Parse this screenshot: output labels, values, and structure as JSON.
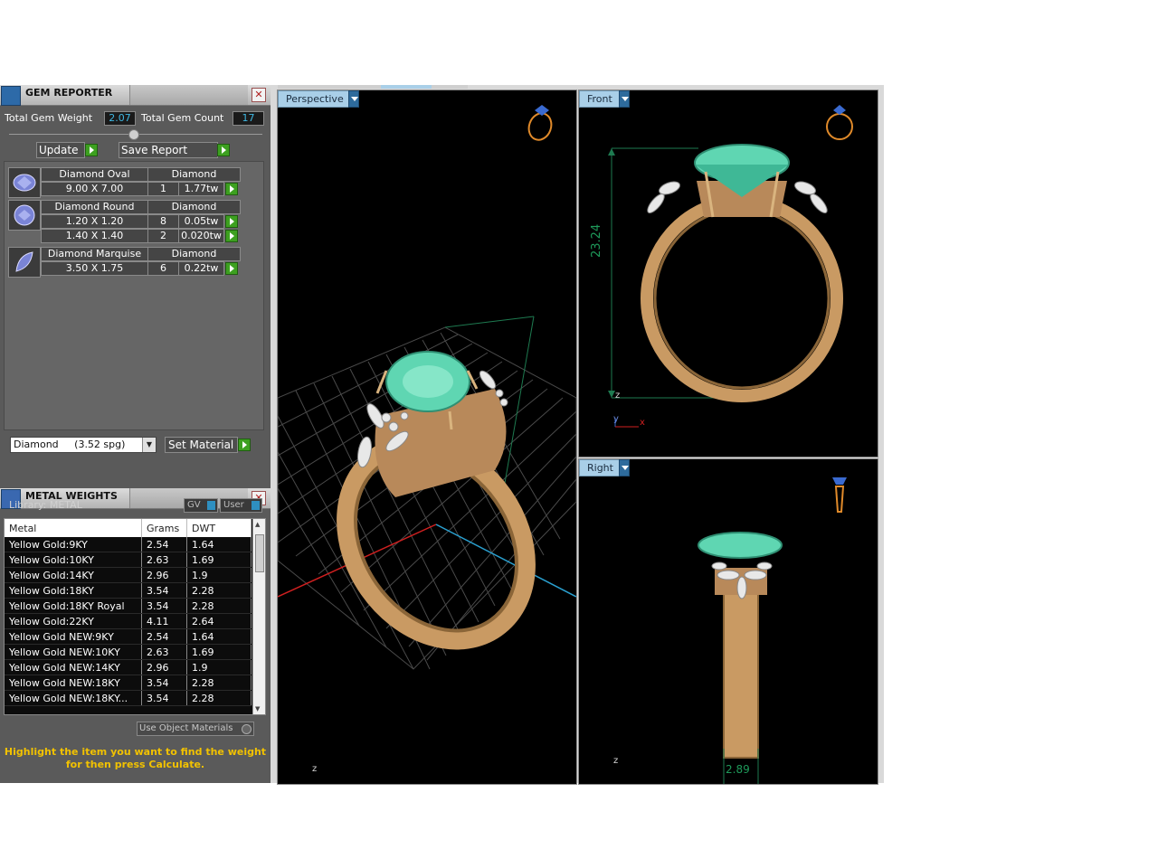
{
  "gem_reporter": {
    "title": "GEM REPORTER",
    "close_icon": "close-icon",
    "total_weight_label": "Total Gem Weight",
    "total_weight_value": "2.07",
    "total_count_label": "Total Gem Count",
    "total_count_value": "17",
    "update_label": "Update",
    "save_report_label": "Save Report",
    "gems": [
      {
        "name": "Diamond Oval",
        "material": "Diamond",
        "rows": [
          {
            "size": "9.00 X 7.00",
            "count": "1",
            "weight": "1.77tw"
          }
        ],
        "icon": "oval-gem-icon"
      },
      {
        "name": "Diamond Round",
        "material": "Diamond",
        "rows": [
          {
            "size": "1.20 X 1.20",
            "count": "8",
            "weight": "0.05tw"
          },
          {
            "size": "1.40 X 1.40",
            "count": "2",
            "weight": "0.020tw"
          }
        ],
        "icon": "round-gem-icon"
      },
      {
        "name": "Diamond Marquise",
        "material": "Diamond",
        "rows": [
          {
            "size": "3.50 X 1.75",
            "count": "6",
            "weight": "0.22tw"
          }
        ],
        "icon": "marquise-gem-icon"
      }
    ],
    "material_select": "Diamond     (3.52 spg)",
    "set_material_label": "Set Material"
  },
  "metal_weights": {
    "title": "METAL WEIGHTS",
    "library_label": "Library: METAL",
    "gv_label": "GV",
    "user_label": "User",
    "columns": [
      "Metal",
      "Grams",
      "DWT"
    ],
    "rows": [
      [
        "Yellow Gold:9KY",
        "2.54",
        "1.64"
      ],
      [
        "Yellow Gold:10KY",
        "2.63",
        "1.69"
      ],
      [
        "Yellow Gold:14KY",
        "2.96",
        "1.9"
      ],
      [
        "Yellow Gold:18KY",
        "3.54",
        "2.28"
      ],
      [
        "Yellow Gold:18KY Royal",
        "3.54",
        "2.28"
      ],
      [
        "Yellow Gold:22KY",
        "4.11",
        "2.64"
      ],
      [
        "Yellow Gold NEW:9KY",
        "2.54",
        "1.64"
      ],
      [
        "Yellow Gold NEW:10KY",
        "2.63",
        "1.69"
      ],
      [
        "Yellow Gold NEW:14KY",
        "2.96",
        "1.9"
      ],
      [
        "Yellow Gold NEW:18KY",
        "3.54",
        "2.28"
      ],
      [
        "Yellow Gold NEW:18KY...",
        "3.54",
        "2.28"
      ]
    ],
    "use_object_materials": "Use Object Materials",
    "hint_line1": "Highlight the item you want to find the weight",
    "hint_line2": "for then press Calculate."
  },
  "viewports": {
    "perspective": {
      "label": "Perspective",
      "axis": "z"
    },
    "front": {
      "label": "Front",
      "dimension": "23.24",
      "axis_z": "z",
      "axis_y": "y",
      "axis_x": "x"
    },
    "right": {
      "label": "Right",
      "dimension": "2.89",
      "axis": "z"
    }
  },
  "colors": {
    "gold": "#c99a63",
    "emerald": "#5fd6b2",
    "viewport_tab": "#a9cfe8",
    "value_text": "#3fb6e0",
    "hint_text": "#f2c200",
    "accent_green": "#3da020"
  }
}
